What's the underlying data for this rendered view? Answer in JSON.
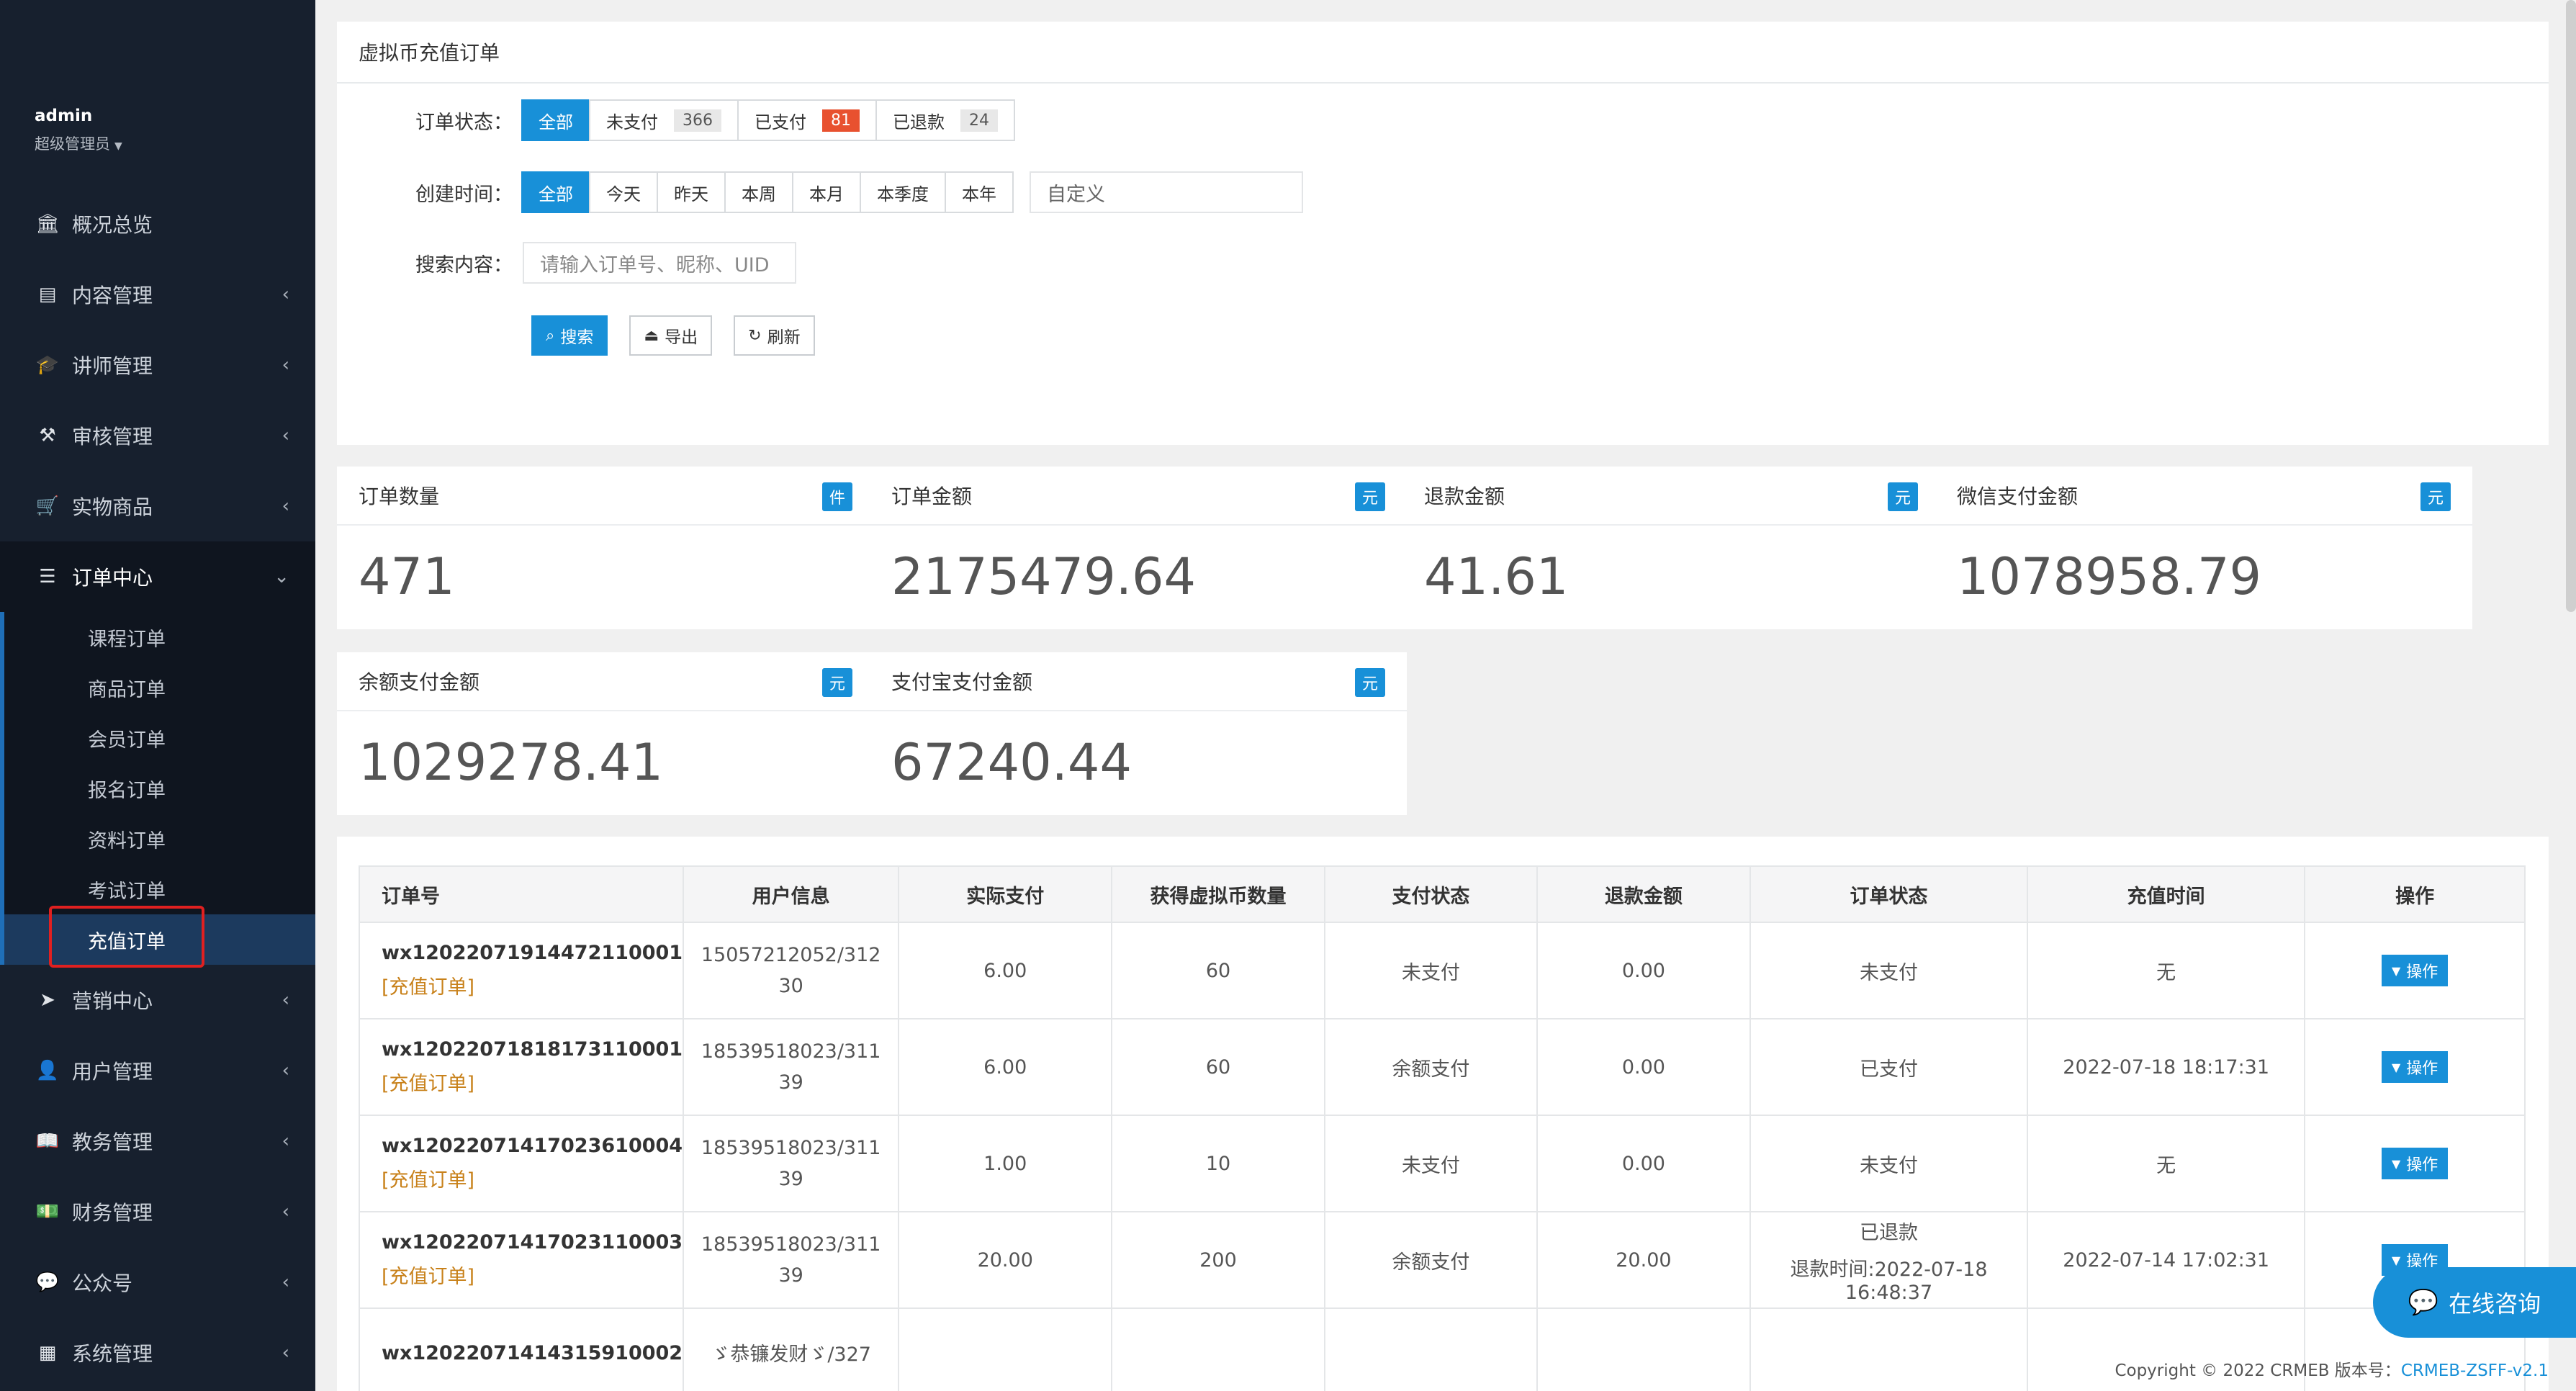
{
  "sidebar": {
    "user_name": "admin",
    "user_role": "超级管理员",
    "menu": [
      {
        "label": "概况总览",
        "icon": "bank-icon",
        "glyph": "🏛"
      },
      {
        "label": "内容管理",
        "icon": "newspaper-icon",
        "glyph": "▤"
      },
      {
        "label": "讲师管理",
        "icon": "graduation-cap-icon",
        "glyph": "🎓"
      },
      {
        "label": "审核管理",
        "icon": "gavel-icon",
        "glyph": "⚒"
      },
      {
        "label": "实物商品",
        "icon": "cart-icon",
        "glyph": "🛒"
      },
      {
        "label": "订单中心",
        "icon": "list-icon",
        "glyph": "☰"
      },
      {
        "label": "营销中心",
        "icon": "send-icon",
        "glyph": "➤"
      },
      {
        "label": "用户管理",
        "icon": "user-icon",
        "glyph": "👤"
      },
      {
        "label": "教务管理",
        "icon": "book-icon",
        "glyph": "📖"
      },
      {
        "label": "财务管理",
        "icon": "money-icon",
        "glyph": "💵"
      },
      {
        "label": "公众号",
        "icon": "wechat-icon",
        "glyph": "💬"
      },
      {
        "label": "系统管理",
        "icon": "grid-icon",
        "glyph": "▦"
      }
    ],
    "submenu": [
      "课程订单",
      "商品订单",
      "会员订单",
      "报名订单",
      "资料订单",
      "考试订单",
      "充值订单"
    ]
  },
  "panel": {
    "title": "虚拟币充值订单",
    "status_label": "订单状态：",
    "status_tabs": [
      {
        "label": "全部",
        "count": ""
      },
      {
        "label": "未支付",
        "count": "366"
      },
      {
        "label": "已支付",
        "count": "81"
      },
      {
        "label": "已退款",
        "count": "24"
      }
    ],
    "time_label": "创建时间：",
    "time_tabs": [
      "全部",
      "今天",
      "昨天",
      "本周",
      "本月",
      "本季度",
      "本年"
    ],
    "custom_date": "自定义",
    "search_label": "搜索内容：",
    "search_placeholder": "请输入订单号、昵称、UID",
    "search_btn": "搜索",
    "export_btn": "导出",
    "refresh_btn": "刷新"
  },
  "stats": [
    {
      "title": "订单数量",
      "unit": "件",
      "value": "471"
    },
    {
      "title": "订单金额",
      "unit": "元",
      "value": "2175479.64"
    },
    {
      "title": "退款金额",
      "unit": "元",
      "value": "41.61"
    },
    {
      "title": "微信支付金额",
      "unit": "元",
      "value": "1078958.79"
    },
    {
      "title": "余额支付金额",
      "unit": "元",
      "value": "1029278.41"
    },
    {
      "title": "支付宝支付金额",
      "unit": "元",
      "value": "67240.44"
    }
  ],
  "table": {
    "headers": [
      "订单号",
      "用户信息",
      "实际支付",
      "获得虚拟币数量",
      "支付状态",
      "退款金额",
      "订单状态",
      "充值时间",
      "操作"
    ],
    "op_label": "操作",
    "rows": [
      {
        "no": "wx12022071914472110001",
        "type": "[充值订单]",
        "user1": "15057212052/312",
        "user2": "30",
        "pay": "6.00",
        "coins": "60",
        "pay_status": "未支付",
        "refund": "0.00",
        "status": "未支付",
        "status2": "",
        "time": "无"
      },
      {
        "no": "wx12022071818173110001",
        "type": "[充值订单]",
        "user1": "18539518023/311",
        "user2": "39",
        "pay": "6.00",
        "coins": "60",
        "pay_status": "余额支付",
        "refund": "0.00",
        "status": "已支付",
        "status2": "",
        "time": "2022-07-18 18:17:31"
      },
      {
        "no": "wx12022071417023610004",
        "type": "[充值订单]",
        "user1": "18539518023/311",
        "user2": "39",
        "pay": "1.00",
        "coins": "10",
        "pay_status": "未支付",
        "refund": "0.00",
        "status": "未支付",
        "status2": "",
        "time": "无"
      },
      {
        "no": "wx12022071417023110003",
        "type": "[充值订单]",
        "user1": "18539518023/311",
        "user2": "39",
        "pay": "20.00",
        "coins": "200",
        "pay_status": "余额支付",
        "refund": "20.00",
        "status": "已退款",
        "status2": "退款时间:2022-07-18 16:48:37",
        "time": "2022-07-14 17:02:31"
      },
      {
        "no": "wx12022071414315910002",
        "type": "",
        "user1": "ゞ恭镰发财ゞ/327",
        "user2": "",
        "pay": "",
        "coins": "",
        "pay_status": "",
        "refund": "",
        "status": "",
        "status2": "",
        "time": ""
      }
    ]
  },
  "footer": {
    "copyright": "Copyright © 2022 CRMEB 版本号：",
    "version": "CRMEB-ZSFF-v2.1"
  },
  "chat": {
    "label": "在线咨询"
  },
  "colors": {
    "primary": "#1890d8",
    "sidebar": "#17202e",
    "highlight": "#e02020",
    "badge_red": "#e8512f"
  }
}
